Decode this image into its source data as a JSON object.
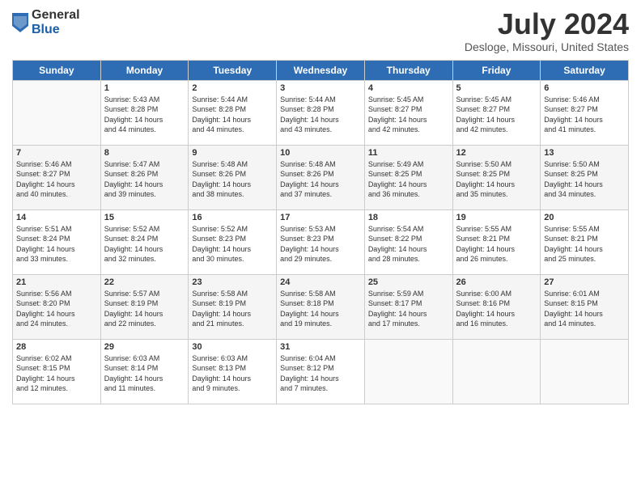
{
  "logo": {
    "general": "General",
    "blue": "Blue"
  },
  "title": "July 2024",
  "subtitle": "Desloge, Missouri, United States",
  "days_of_week": [
    "Sunday",
    "Monday",
    "Tuesday",
    "Wednesday",
    "Thursday",
    "Friday",
    "Saturday"
  ],
  "weeks": [
    [
      {
        "day": "",
        "info": ""
      },
      {
        "day": "1",
        "info": "Sunrise: 5:43 AM\nSunset: 8:28 PM\nDaylight: 14 hours\nand 44 minutes."
      },
      {
        "day": "2",
        "info": "Sunrise: 5:44 AM\nSunset: 8:28 PM\nDaylight: 14 hours\nand 44 minutes."
      },
      {
        "day": "3",
        "info": "Sunrise: 5:44 AM\nSunset: 8:28 PM\nDaylight: 14 hours\nand 43 minutes."
      },
      {
        "day": "4",
        "info": "Sunrise: 5:45 AM\nSunset: 8:27 PM\nDaylight: 14 hours\nand 42 minutes."
      },
      {
        "day": "5",
        "info": "Sunrise: 5:45 AM\nSunset: 8:27 PM\nDaylight: 14 hours\nand 42 minutes."
      },
      {
        "day": "6",
        "info": "Sunrise: 5:46 AM\nSunset: 8:27 PM\nDaylight: 14 hours\nand 41 minutes."
      }
    ],
    [
      {
        "day": "7",
        "info": "Sunrise: 5:46 AM\nSunset: 8:27 PM\nDaylight: 14 hours\nand 40 minutes."
      },
      {
        "day": "8",
        "info": "Sunrise: 5:47 AM\nSunset: 8:26 PM\nDaylight: 14 hours\nand 39 minutes."
      },
      {
        "day": "9",
        "info": "Sunrise: 5:48 AM\nSunset: 8:26 PM\nDaylight: 14 hours\nand 38 minutes."
      },
      {
        "day": "10",
        "info": "Sunrise: 5:48 AM\nSunset: 8:26 PM\nDaylight: 14 hours\nand 37 minutes."
      },
      {
        "day": "11",
        "info": "Sunrise: 5:49 AM\nSunset: 8:25 PM\nDaylight: 14 hours\nand 36 minutes."
      },
      {
        "day": "12",
        "info": "Sunrise: 5:50 AM\nSunset: 8:25 PM\nDaylight: 14 hours\nand 35 minutes."
      },
      {
        "day": "13",
        "info": "Sunrise: 5:50 AM\nSunset: 8:25 PM\nDaylight: 14 hours\nand 34 minutes."
      }
    ],
    [
      {
        "day": "14",
        "info": "Sunrise: 5:51 AM\nSunset: 8:24 PM\nDaylight: 14 hours\nand 33 minutes."
      },
      {
        "day": "15",
        "info": "Sunrise: 5:52 AM\nSunset: 8:24 PM\nDaylight: 14 hours\nand 32 minutes."
      },
      {
        "day": "16",
        "info": "Sunrise: 5:52 AM\nSunset: 8:23 PM\nDaylight: 14 hours\nand 30 minutes."
      },
      {
        "day": "17",
        "info": "Sunrise: 5:53 AM\nSunset: 8:23 PM\nDaylight: 14 hours\nand 29 minutes."
      },
      {
        "day": "18",
        "info": "Sunrise: 5:54 AM\nSunset: 8:22 PM\nDaylight: 14 hours\nand 28 minutes."
      },
      {
        "day": "19",
        "info": "Sunrise: 5:55 AM\nSunset: 8:21 PM\nDaylight: 14 hours\nand 26 minutes."
      },
      {
        "day": "20",
        "info": "Sunrise: 5:55 AM\nSunset: 8:21 PM\nDaylight: 14 hours\nand 25 minutes."
      }
    ],
    [
      {
        "day": "21",
        "info": "Sunrise: 5:56 AM\nSunset: 8:20 PM\nDaylight: 14 hours\nand 24 minutes."
      },
      {
        "day": "22",
        "info": "Sunrise: 5:57 AM\nSunset: 8:19 PM\nDaylight: 14 hours\nand 22 minutes."
      },
      {
        "day": "23",
        "info": "Sunrise: 5:58 AM\nSunset: 8:19 PM\nDaylight: 14 hours\nand 21 minutes."
      },
      {
        "day": "24",
        "info": "Sunrise: 5:58 AM\nSunset: 8:18 PM\nDaylight: 14 hours\nand 19 minutes."
      },
      {
        "day": "25",
        "info": "Sunrise: 5:59 AM\nSunset: 8:17 PM\nDaylight: 14 hours\nand 17 minutes."
      },
      {
        "day": "26",
        "info": "Sunrise: 6:00 AM\nSunset: 8:16 PM\nDaylight: 14 hours\nand 16 minutes."
      },
      {
        "day": "27",
        "info": "Sunrise: 6:01 AM\nSunset: 8:15 PM\nDaylight: 14 hours\nand 14 minutes."
      }
    ],
    [
      {
        "day": "28",
        "info": "Sunrise: 6:02 AM\nSunset: 8:15 PM\nDaylight: 14 hours\nand 12 minutes."
      },
      {
        "day": "29",
        "info": "Sunrise: 6:03 AM\nSunset: 8:14 PM\nDaylight: 14 hours\nand 11 minutes."
      },
      {
        "day": "30",
        "info": "Sunrise: 6:03 AM\nSunset: 8:13 PM\nDaylight: 14 hours\nand 9 minutes."
      },
      {
        "day": "31",
        "info": "Sunrise: 6:04 AM\nSunset: 8:12 PM\nDaylight: 14 hours\nand 7 minutes."
      },
      {
        "day": "",
        "info": ""
      },
      {
        "day": "",
        "info": ""
      },
      {
        "day": "",
        "info": ""
      }
    ]
  ]
}
